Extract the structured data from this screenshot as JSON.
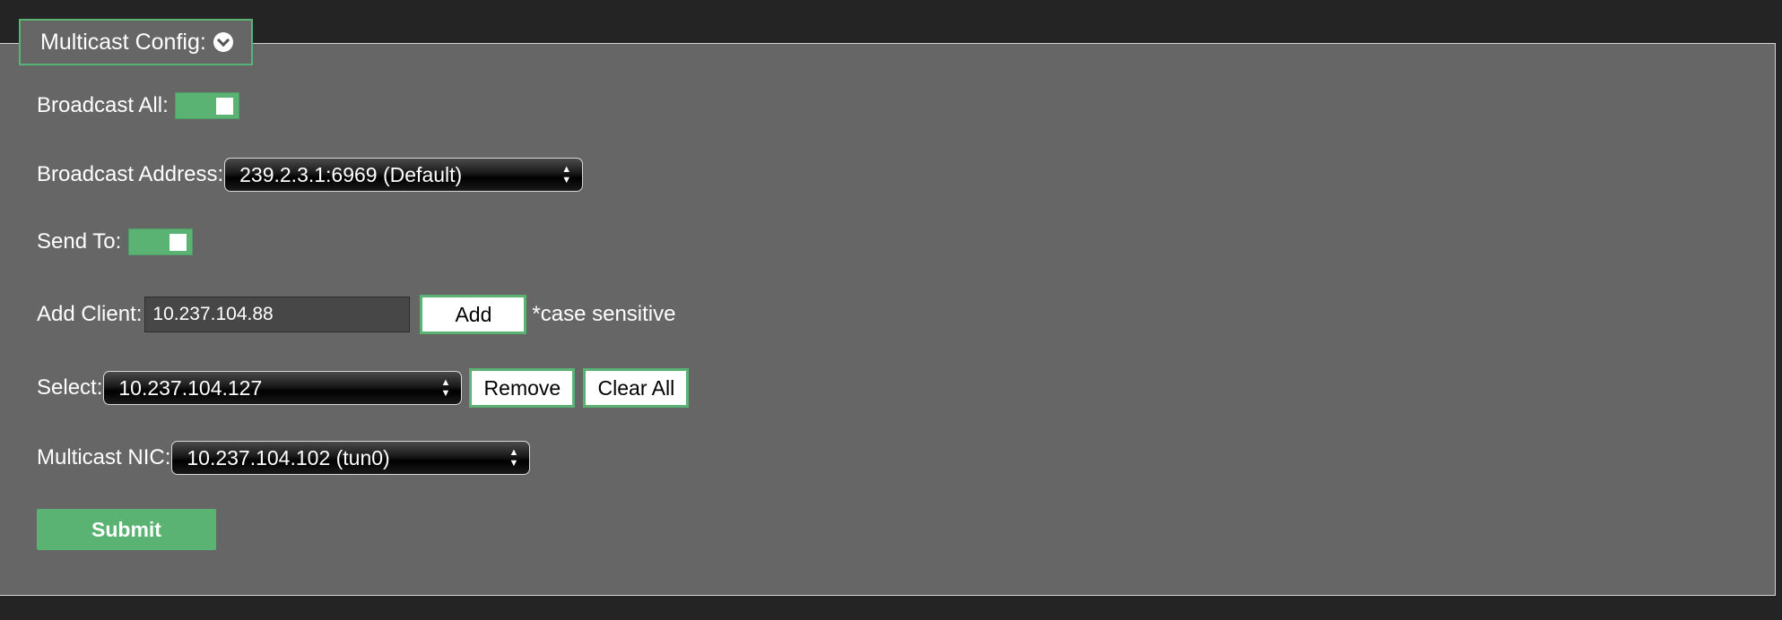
{
  "section": {
    "title": "Multicast Config:",
    "icon": "chevron-down-circle-icon"
  },
  "broadcast_all": {
    "label": "Broadcast All:",
    "state": "on"
  },
  "broadcast_address": {
    "label": "Broadcast Address:",
    "value": "239.2.3.1:6969 (Default)"
  },
  "send_to": {
    "label": "Send To:",
    "state": "on"
  },
  "add_client": {
    "label": "Add Client:",
    "value": "10.237.104.88",
    "button": "Add",
    "note": "*case sensitive"
  },
  "select": {
    "label": "Select:",
    "value": "10.237.104.127",
    "remove_button": "Remove",
    "clear_button": "Clear All"
  },
  "multicast_nic": {
    "label": "Multicast NIC:",
    "value": "10.237.104.102 (tun0)"
  },
  "submit": {
    "label": "Submit"
  },
  "colors": {
    "accent": "#5ab373",
    "panel": "#666666",
    "background": "#242424"
  }
}
